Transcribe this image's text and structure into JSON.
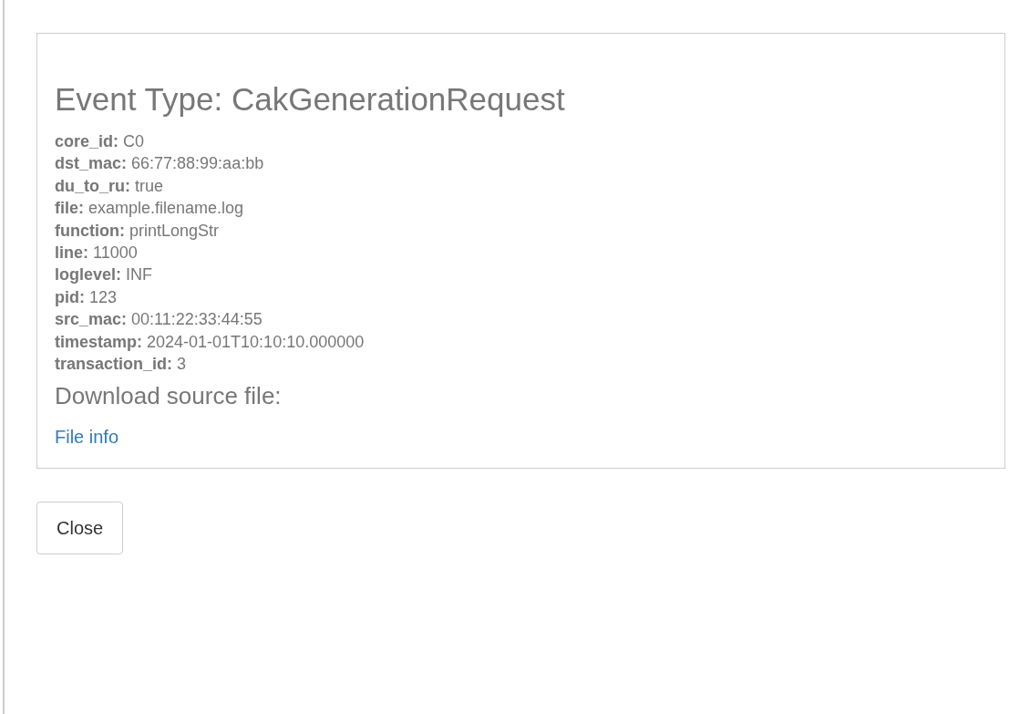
{
  "event_panel": {
    "title": "Event Type: CakGenerationRequest",
    "fields": [
      {
        "key": "core_id:",
        "value": "C0"
      },
      {
        "key": "dst_mac:",
        "value": "66:77:88:99:aa:bb"
      },
      {
        "key": "du_to_ru:",
        "value": "true"
      },
      {
        "key": "file:",
        "value": "example.filename.log"
      },
      {
        "key": "function:",
        "value": "printLongStr"
      },
      {
        "key": "line:",
        "value": "11000"
      },
      {
        "key": "loglevel:",
        "value": "INF"
      },
      {
        "key": "pid:",
        "value": "123"
      },
      {
        "key": "src_mac:",
        "value": "00:11:22:33:44:55"
      },
      {
        "key": "timestamp:",
        "value": "2024-01-01T10:10:10.000000"
      },
      {
        "key": "transaction_id:",
        "value": "3"
      }
    ],
    "download_heading": "Download source file:",
    "link": "File info"
  },
  "buttons": [
    "Close"
  ]
}
